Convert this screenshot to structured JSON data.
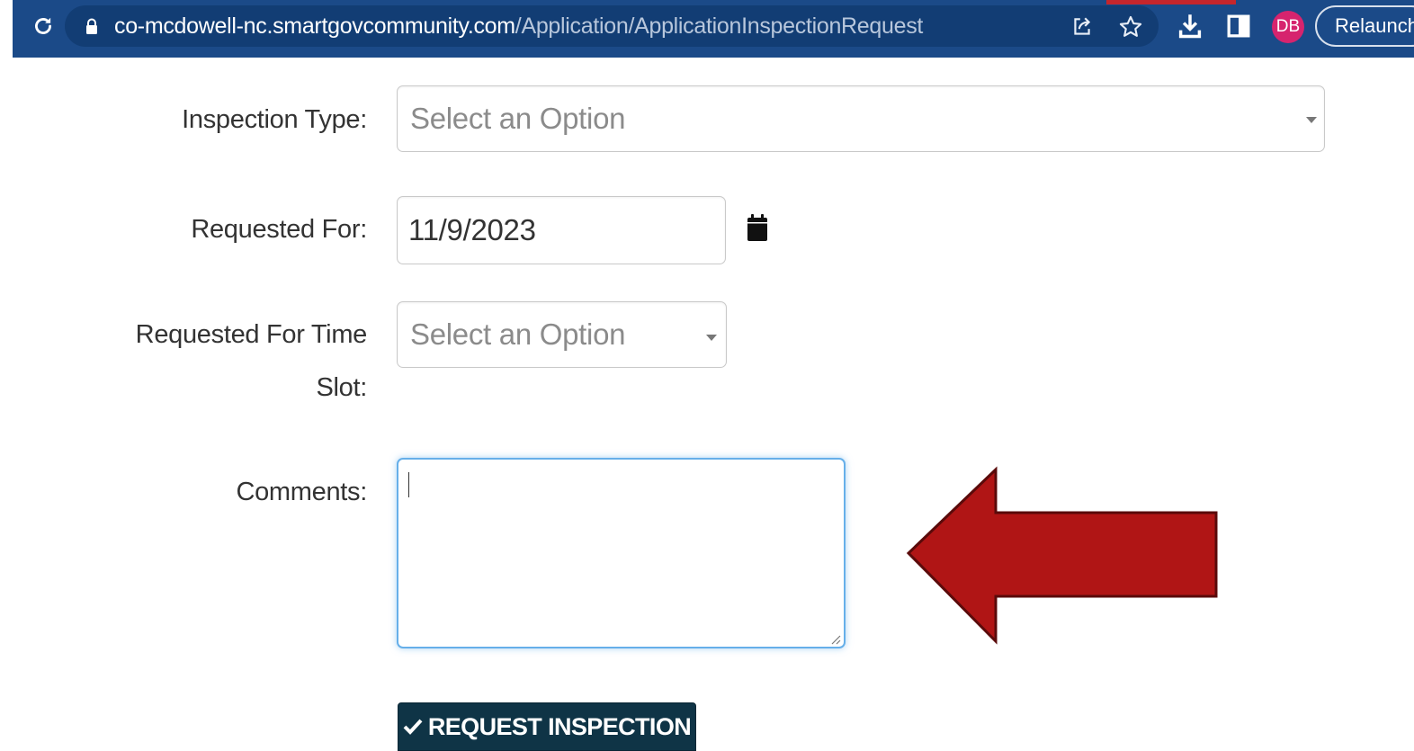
{
  "browser": {
    "url_domain": "co-mcdowell-nc.smartgovcommunity.com",
    "url_path": "/Application/ApplicationInspectionRequest",
    "profile_initials": "DB",
    "relaunch_label": "Relaunch",
    "icons": [
      "reload-icon",
      "lock-icon",
      "share-icon",
      "star-icon",
      "download-icon",
      "side-panel-icon"
    ],
    "colors": {
      "toolbar": "#1b4a88",
      "omnibox": "#123d74",
      "avatar": "#d6246e"
    }
  },
  "form": {
    "inspection_type": {
      "label": "Inspection Type:",
      "placeholder": "Select an Option"
    },
    "requested_for": {
      "label": "Requested For:",
      "value": "11/9/2023",
      "icon": "calendar-icon"
    },
    "time_slot": {
      "label_line1": "Requested For Time",
      "label_line2": "Slot:",
      "placeholder": "Select an Option"
    },
    "comments": {
      "label": "Comments:",
      "value": ""
    },
    "submit": {
      "icon": "check-icon",
      "label": "REQUEST INSPECTION"
    }
  },
  "annotation": {
    "shape": "left-arrow",
    "color": "#b01515",
    "points_to": "comments"
  },
  "colors": {
    "button": "#0f3446",
    "focus_border": "#66afe9"
  }
}
